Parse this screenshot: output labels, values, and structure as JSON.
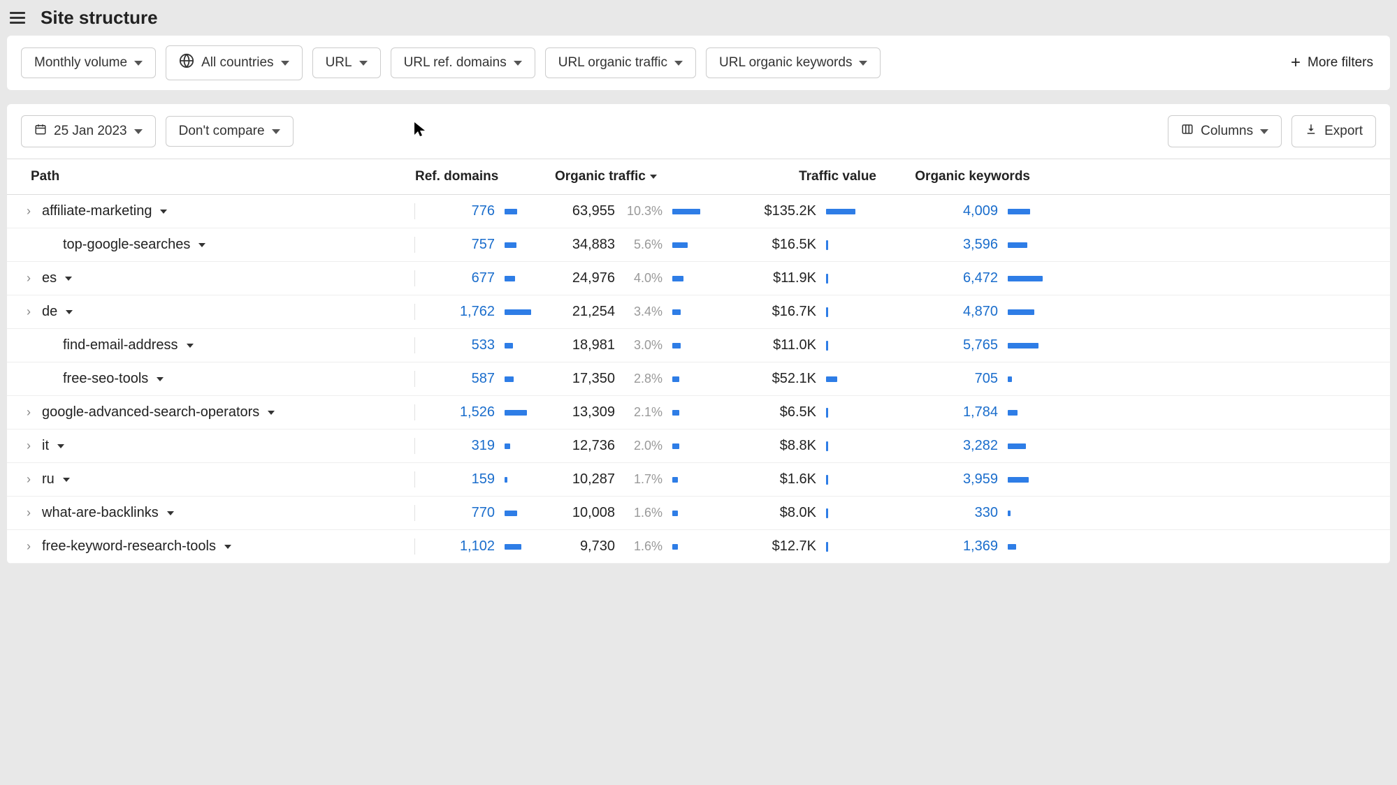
{
  "header": {
    "title": "Site structure"
  },
  "filters": {
    "volume": "Monthly volume",
    "countries": "All countries",
    "url": "URL",
    "ref_domains": "URL ref. domains",
    "org_traffic": "URL organic traffic",
    "org_keywords": "URL organic keywords",
    "more": "More filters"
  },
  "toolbar": {
    "date": "25 Jan 2023",
    "compare": "Don't compare",
    "columns": "Columns",
    "export": "Export"
  },
  "columns": {
    "path": "Path",
    "ref": "Ref. domains",
    "org": "Organic traffic",
    "tv": "Traffic value",
    "okw": "Organic keywords"
  },
  "rows": [
    {
      "path": "affiliate-marketing",
      "expandable": true,
      "indent": 0,
      "ref": "776",
      "ref_bar": 18,
      "org": "63,955",
      "org_pct": "10.3%",
      "org_bar": 40,
      "tv": "$135.2K",
      "tv_bar": 42,
      "okw": "4,009",
      "okw_bar": 32
    },
    {
      "path": "top-google-searches",
      "expandable": false,
      "indent": 1,
      "ref": "757",
      "ref_bar": 17,
      "org": "34,883",
      "org_pct": "5.6%",
      "org_bar": 22,
      "tv": "$16.5K",
      "tv_bar": 4,
      "okw": "3,596",
      "okw_bar": 28
    },
    {
      "path": "es",
      "expandable": true,
      "indent": 0,
      "ref": "677",
      "ref_bar": 15,
      "org": "24,976",
      "org_pct": "4.0%",
      "org_bar": 16,
      "tv": "$11.9K",
      "tv_bar": 4,
      "okw": "6,472",
      "okw_bar": 50
    },
    {
      "path": "de",
      "expandable": true,
      "indent": 0,
      "ref": "1,762",
      "ref_bar": 38,
      "org": "21,254",
      "org_pct": "3.4%",
      "org_bar": 12,
      "tv": "$16.7K",
      "tv_bar": 4,
      "okw": "4,870",
      "okw_bar": 38
    },
    {
      "path": "find-email-address",
      "expandable": false,
      "indent": 1,
      "ref": "533",
      "ref_bar": 12,
      "org": "18,981",
      "org_pct": "3.0%",
      "org_bar": 12,
      "tv": "$11.0K",
      "tv_bar": 4,
      "okw": "5,765",
      "okw_bar": 44
    },
    {
      "path": "free-seo-tools",
      "expandable": false,
      "indent": 1,
      "ref": "587",
      "ref_bar": 13,
      "org": "17,350",
      "org_pct": "2.8%",
      "org_bar": 10,
      "tv": "$52.1K",
      "tv_bar": 16,
      "okw": "705",
      "okw_bar": 6
    },
    {
      "path": "google-advanced-search-operators",
      "expandable": true,
      "indent": 0,
      "ref": "1,526",
      "ref_bar": 32,
      "org": "13,309",
      "org_pct": "2.1%",
      "org_bar": 10,
      "tv": "$6.5K",
      "tv_bar": 3,
      "okw": "1,784",
      "okw_bar": 14
    },
    {
      "path": "it",
      "expandable": true,
      "indent": 0,
      "ref": "319",
      "ref_bar": 8,
      "org": "12,736",
      "org_pct": "2.0%",
      "org_bar": 10,
      "tv": "$8.8K",
      "tv_bar": 4,
      "okw": "3,282",
      "okw_bar": 26
    },
    {
      "path": "ru",
      "expandable": true,
      "indent": 0,
      "ref": "159",
      "ref_bar": 4,
      "org": "10,287",
      "org_pct": "1.7%",
      "org_bar": 8,
      "tv": "$1.6K",
      "tv_bar": 2,
      "okw": "3,959",
      "okw_bar": 30
    },
    {
      "path": "what-are-backlinks",
      "expandable": true,
      "indent": 0,
      "ref": "770",
      "ref_bar": 18,
      "org": "10,008",
      "org_pct": "1.6%",
      "org_bar": 8,
      "tv": "$8.0K",
      "tv_bar": 4,
      "okw": "330",
      "okw_bar": 4
    },
    {
      "path": "free-keyword-research-tools",
      "expandable": true,
      "indent": 0,
      "ref": "1,102",
      "ref_bar": 24,
      "org": "9,730",
      "org_pct": "1.6%",
      "org_bar": 8,
      "tv": "$12.7K",
      "tv_bar": 4,
      "okw": "1,369",
      "okw_bar": 12
    }
  ]
}
